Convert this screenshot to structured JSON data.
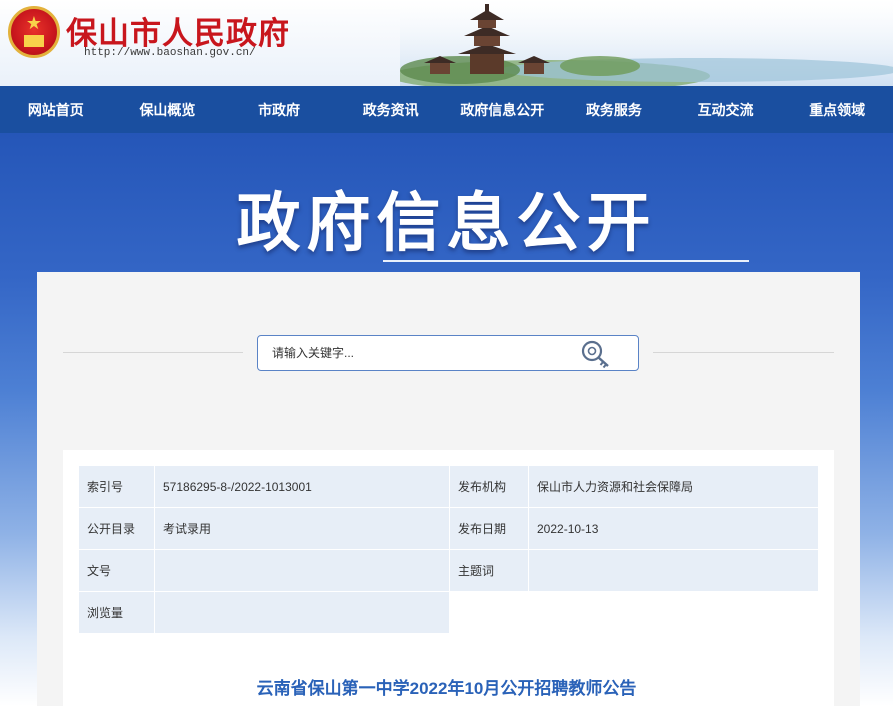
{
  "header": {
    "site_title": "保山市人民政府",
    "site_url": "http://www.baoshan.gov.cn/"
  },
  "nav": [
    "网站首页",
    "保山概览",
    "市政府",
    "政务资讯",
    "政府信息公开",
    "政务服务",
    "互动交流",
    "重点领域"
  ],
  "banner": {
    "title": "政府信息公开"
  },
  "search": {
    "placeholder": "请输入关键字..."
  },
  "meta": {
    "index_label": "索引号",
    "index_value": "57186295-8-/2022-1013001",
    "publisher_label": "发布机构",
    "publisher_value": "保山市人力资源和社会保障局",
    "catalog_label": "公开目录",
    "catalog_value": "考试录用",
    "date_label": "发布日期",
    "date_value": "2022-10-13",
    "docno_label": "文号",
    "docno_value": "",
    "subject_label": "主题词",
    "subject_value": "",
    "views_label": "浏览量",
    "views_value": ""
  },
  "document": {
    "title": "云南省保山第一中学2022年10月公开招聘教师公告"
  },
  "colors": {
    "nav_bg": "#1a4fa0",
    "brand_red": "#c8161d",
    "title_blue": "#2a62b8"
  }
}
